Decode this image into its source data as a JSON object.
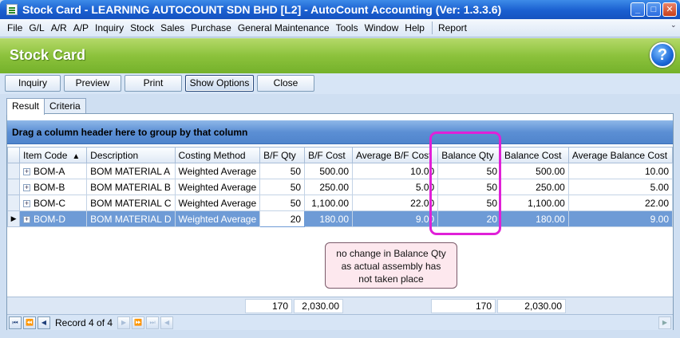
{
  "window": {
    "title": "Stock Card - LEARNING AUTOCOUNT SDN BHD [L2] - AutoCount Accounting (Ver: 1.3.3.6)",
    "minimize": "_",
    "maximize": "□",
    "close": "✕"
  },
  "menu": {
    "items": [
      "File",
      "G/L",
      "A/R",
      "A/P",
      "Inquiry",
      "Stock",
      "Sales",
      "Purchase",
      "General Maintenance",
      "Tools",
      "Window",
      "Help"
    ],
    "report": "Report"
  },
  "header": {
    "title": "Stock Card",
    "help": "?"
  },
  "toolbar": {
    "inquiry": "Inquiry",
    "preview": "Preview",
    "print": "Print",
    "show_options": "Show Options",
    "close": "Close"
  },
  "tabs": {
    "result": "Result",
    "criteria": "Criteria"
  },
  "grid": {
    "group_hint": "Drag a column header here to group by that column",
    "columns": [
      "Item Code",
      "Description",
      "Costing Method",
      "B/F Qty",
      "B/F Cost",
      "Average B/F Cost",
      "Balance Qty",
      "Balance Cost",
      "Average Balance Cost"
    ],
    "rows": [
      [
        "BOM-A",
        "BOM MATERIAL A",
        "Weighted Average",
        "50",
        "500.00",
        "10.00",
        "50",
        "500.00",
        "10.00"
      ],
      [
        "BOM-B",
        "BOM MATERIAL B",
        "Weighted Average",
        "50",
        "250.00",
        "5.00",
        "50",
        "250.00",
        "5.00"
      ],
      [
        "BOM-C",
        "BOM MATERIAL C",
        "Weighted Average",
        "50",
        "1,100.00",
        "22.00",
        "50",
        "1,100.00",
        "22.00"
      ],
      [
        "BOM-D",
        "BOM MATERIAL D",
        "Weighted Average",
        "20",
        "180.00",
        "9.00",
        "20",
        "180.00",
        "9.00"
      ]
    ],
    "totals": {
      "bf_qty": "170",
      "bf_cost": "2,030.00",
      "balance_qty": "170",
      "balance_cost": "2,030.00"
    }
  },
  "callout": {
    "lines": [
      "no change in Balance Qty",
      "as actual assembly has",
      "not taken place"
    ]
  },
  "navigator": {
    "record_text": "Record 4 of 4"
  },
  "colors": {
    "title_bar": "#1a5fd0",
    "header_green": "#8cc23c",
    "highlight": "#e020d8",
    "callout_bg": "#fde8ee",
    "focused_row": "#6e9bd6"
  }
}
